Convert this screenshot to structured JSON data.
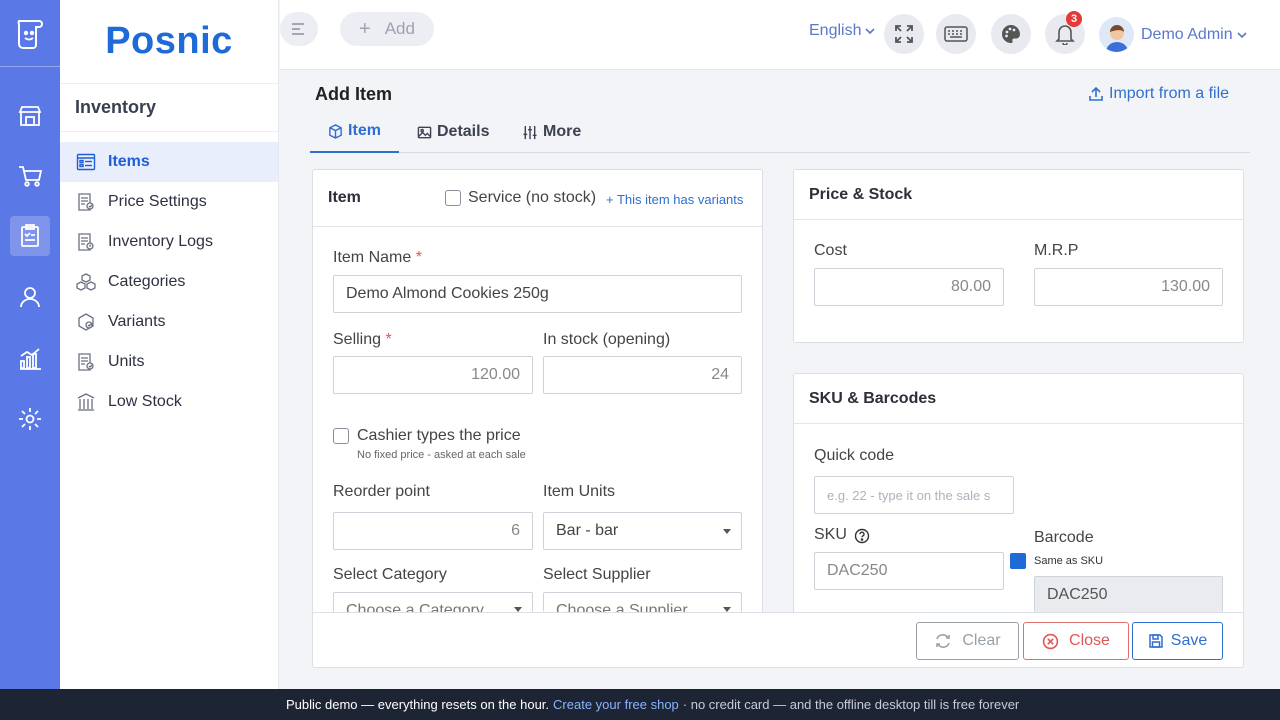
{
  "brand": {
    "name": "Posnic"
  },
  "rail": {
    "items": [
      {
        "name": "store-icon"
      },
      {
        "name": "cart-icon"
      },
      {
        "name": "inventory-icon"
      },
      {
        "name": "user-icon"
      },
      {
        "name": "reports-icon"
      },
      {
        "name": "settings-icon"
      }
    ],
    "active": "inventory-icon"
  },
  "sidebar": {
    "title": "Inventory",
    "items": [
      {
        "label": "Items",
        "icon": "list-icon"
      },
      {
        "label": "Price Settings",
        "icon": "price-doc-icon"
      },
      {
        "label": "Inventory Logs",
        "icon": "log-doc-icon"
      },
      {
        "label": "Categories",
        "icon": "cubes-icon"
      },
      {
        "label": "Variants",
        "icon": "variants-icon"
      },
      {
        "label": "Units",
        "icon": "units-doc-icon"
      },
      {
        "label": "Low Stock",
        "icon": "low-stock-icon"
      }
    ],
    "active": "Items"
  },
  "topbar": {
    "add_label": "Add",
    "add_plus": "+",
    "language": "English",
    "notifications_count": "3",
    "user_name": "Demo Admin"
  },
  "page": {
    "title": "Add Item",
    "import_label": "Import from a file"
  },
  "tabs": [
    {
      "label": "Item",
      "icon": "cube-icon"
    },
    {
      "label": "Details",
      "icon": "image-icon"
    },
    {
      "label": "More",
      "icon": "sliders-icon"
    }
  ],
  "item_card": {
    "title": "Item",
    "service_label": "Service (no stock)",
    "variants_link": "+ This item has variants",
    "item_name_label": "Item Name",
    "item_name_value": "Demo Almond Cookies 250g",
    "selling_label": "Selling",
    "selling_value": "120.00",
    "in_stock_label": "In stock (opening)",
    "in_stock_value": "24",
    "cashier_label": "Cashier types the price",
    "cashier_help": "No fixed price - asked at each sale",
    "reorder_label": "Reorder point",
    "reorder_value": "6",
    "units_label": "Item Units",
    "units_value": "Bar - bar",
    "category_label": "Select Category",
    "category_placeholder": "Choose a Category",
    "supplier_label": "Select Supplier",
    "supplier_placeholder": "Choose a Supplier",
    "required_mark": "*"
  },
  "price_card": {
    "title": "Price & Stock",
    "cost_label": "Cost",
    "cost_value": "80.00",
    "mrp_label": "M.R.P",
    "mrp_value": "130.00"
  },
  "sku_card": {
    "title": "SKU & Barcodes",
    "quick_code_label": "Quick code",
    "quick_code_placeholder": "e.g. 22 - type it on the sale s",
    "sku_label": "SKU",
    "sku_value": "DAC250",
    "barcode_label": "Barcode",
    "same_as_sku_label": "Same as SKU",
    "barcode_value": "DAC250"
  },
  "actions": {
    "clear": "Clear",
    "close": "Close",
    "save": "Save"
  },
  "banner": {
    "text": "Public demo — everything resets on the hour.",
    "link": "Create your free shop",
    "tail": "· no credit card — and the offline desktop till is free forever"
  },
  "colors": {
    "rail": "#5a78e6",
    "brand": "#1e6ad6",
    "accent": "#2f6fd0",
    "close_red": "#e05656",
    "banner_bg": "#1d2433"
  }
}
